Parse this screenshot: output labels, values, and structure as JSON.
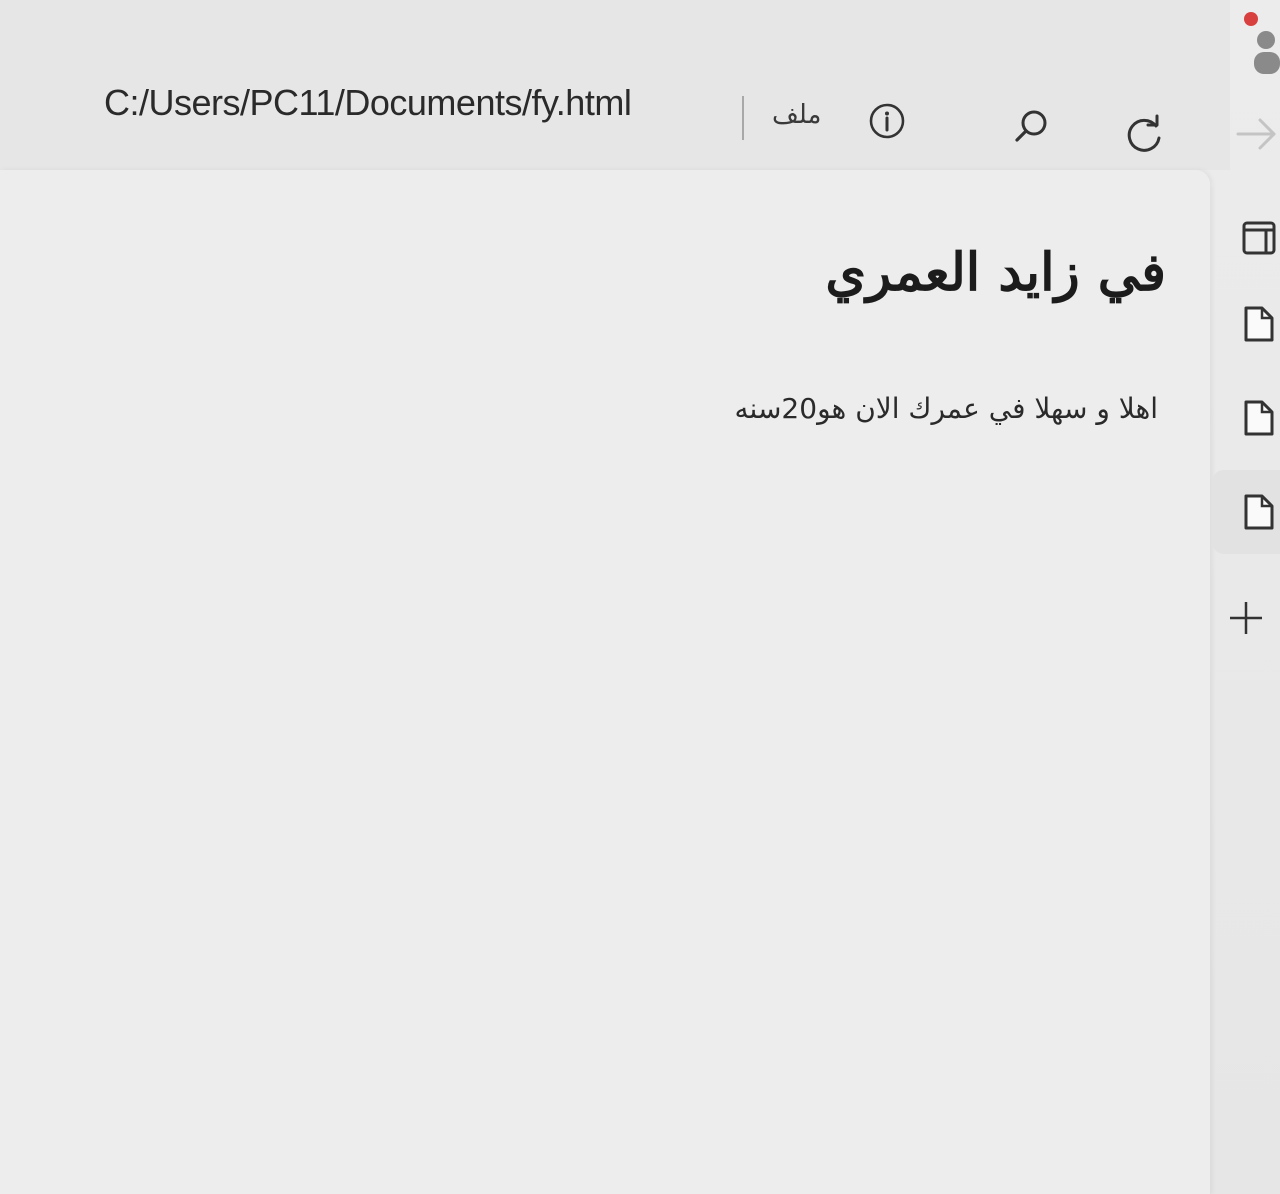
{
  "browser": {
    "address": "C:/Users/PC11/Documents/fy.html",
    "scheme_label": "ملف",
    "icons": {
      "info": "info-icon",
      "search": "search-icon",
      "reload": "reload-icon",
      "forward": "forward-arrow-icon"
    }
  },
  "page": {
    "title": "في زايد العمري",
    "text": "اهلا و سهلا في عمرك الان هو20سنه"
  },
  "sidebar": {
    "icons": [
      "tab-layout-icon",
      "document-icon",
      "document-icon",
      "document-icon",
      "add-icon"
    ]
  },
  "colors": {
    "background": "#ececec",
    "text": "#1c1c1c",
    "accent_dot": "#d84040"
  }
}
